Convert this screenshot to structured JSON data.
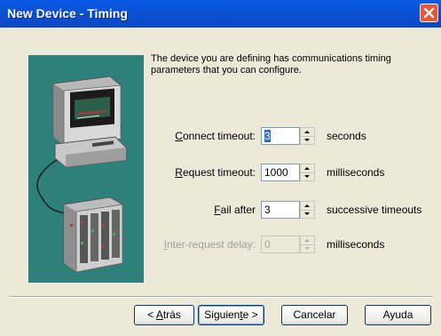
{
  "window": {
    "title": "New Device - Timing"
  },
  "description": "The device you are defining has communications timing parameters that you can configure.",
  "fields": {
    "connect_timeout": {
      "label_pre": "",
      "label_key": "C",
      "label_post": "onnect timeout:",
      "value": "3",
      "unit": "seconds"
    },
    "request_timeout": {
      "label_pre": "",
      "label_key": "R",
      "label_post": "equest timeout:",
      "value": "1000",
      "unit": "milliseconds"
    },
    "fail_after": {
      "label_pre": "",
      "label_key": "F",
      "label_post": "ail after",
      "value": "3",
      "unit": "successive timeouts"
    },
    "inter_request_delay": {
      "label_pre": "",
      "label_key": "I",
      "label_post": "nter-request delay:",
      "value": "0",
      "unit": "milliseconds"
    }
  },
  "buttons": {
    "back": {
      "pre": "< ",
      "key": "A",
      "post": "trás"
    },
    "next": {
      "pre": "Siguien",
      "key": "t",
      "post": "e >"
    },
    "cancel": "Cancelar",
    "help": "Ayuda"
  },
  "colors": {
    "titlebar": "#0a5be6",
    "picture_bg": "#2f7f7b",
    "dialog_bg": "#ece9d8"
  },
  "icons": [
    "close-icon",
    "computer-icon",
    "device-rack-icon",
    "spin-up-icon",
    "spin-down-icon"
  ]
}
